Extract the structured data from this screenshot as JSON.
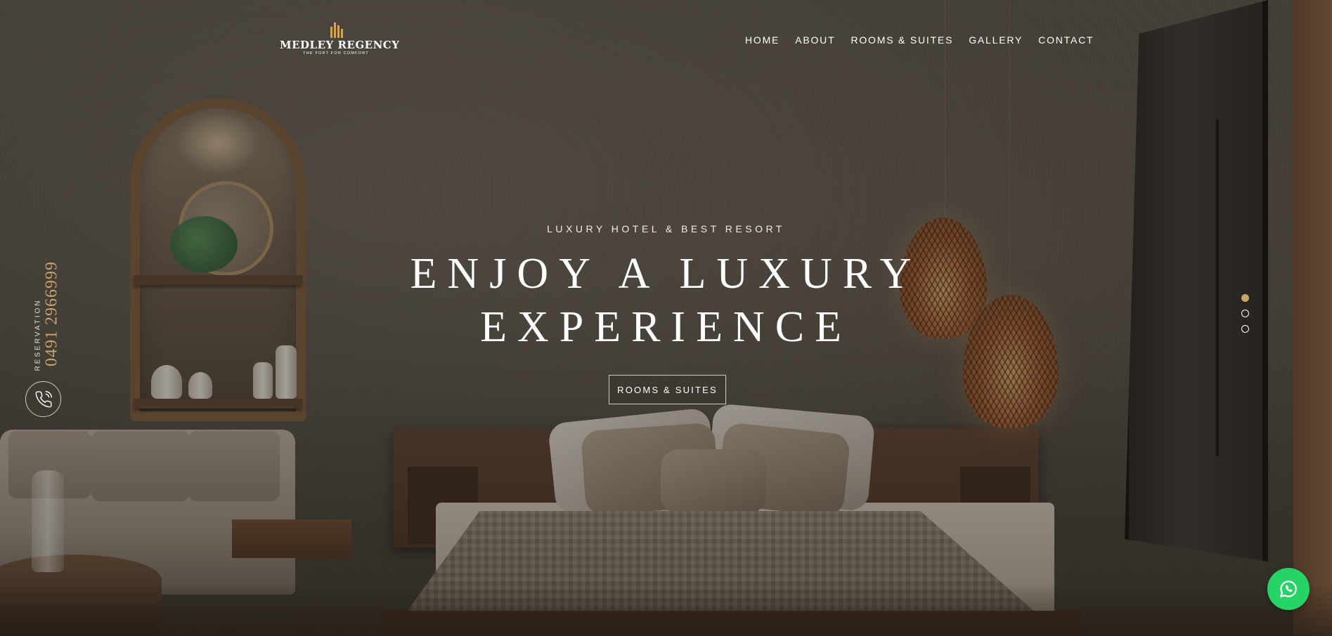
{
  "brand": {
    "name": "MEDLEY REGENCY",
    "tagline": "THE FORT FOR COMFORT",
    "accent_color": "#c9a56a",
    "logo_mark_color": "#d9a441"
  },
  "nav": {
    "items": [
      {
        "label": "HOME"
      },
      {
        "label": "ABOUT"
      },
      {
        "label": "ROOMS & SUITES"
      },
      {
        "label": "GALLERY"
      },
      {
        "label": "CONTACT"
      }
    ]
  },
  "hero": {
    "subtitle": "LUXURY HOTEL & BEST RESORT",
    "title_line1": "ENJOY A LUXURY",
    "title_line2": "EXPERIENCE",
    "cta_label": "ROOMS & SUITES"
  },
  "reservation": {
    "label": "RESERVATION",
    "phone": "0491 2966999",
    "icon": "phone-icon"
  },
  "slider": {
    "total": 3,
    "active_index": 0
  },
  "whatsapp": {
    "icon": "whatsapp-icon",
    "color": "#25d366"
  }
}
